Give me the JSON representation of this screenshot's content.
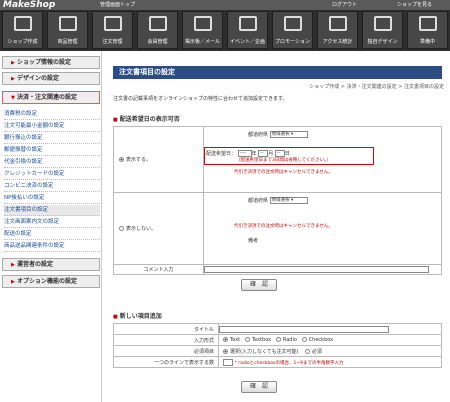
{
  "topbar": {
    "logo": "MakeShop",
    "admin_top": "管理画面トップ",
    "logout": "ログアウト",
    "to_shop": "ショップを見る"
  },
  "nav": [
    {
      "label": "ショップ作成"
    },
    {
      "label": "商品管理"
    },
    {
      "label": "注文管理"
    },
    {
      "label": "会員管理"
    },
    {
      "label": "掲示板／メール"
    },
    {
      "label": "イベント／企画"
    },
    {
      "label": "プロモーション"
    },
    {
      "label": "アクセス統計"
    },
    {
      "label": "独自デザイン"
    },
    {
      "label": "準備中"
    }
  ],
  "sidebar": {
    "head1": "ショップ情報の設定",
    "head2": "デザインの設定",
    "head3": "決済・注文関連の設定",
    "items": [
      "消費税の設定",
      "注文可能最小金額の設定",
      "銀行振込の設定",
      "郵便振替の設定",
      "代金引換の設定",
      "クレジットカードの設定",
      "コンビニ決済の設定",
      "NP後払いの設定",
      "注文書項目の設定",
      "注文画面案内文の設定",
      "配送の設定",
      "商品送品関連条件の設定"
    ],
    "head4": "運営者の設定",
    "head5": "オプション機能の設定"
  },
  "main": {
    "title": "注文書項目の設定",
    "breadcrumb": "ショップ作成 > 決済・注文関連の設定 > 注文書項目の設定",
    "description": "注文書の記載事項をオンラインショップの特性に合わせて追加設定できます。",
    "sec1": "配送希望日の表示可否",
    "show": "表示する。",
    "hide": "表示しない。",
    "pref_label": "都道府県",
    "pref_select": "地域選択",
    "date_label": "配送希望日：",
    "date_y": "----",
    "year": "年",
    "date_m": "--",
    "month": "月",
    "date_d": "--",
    "day": "日",
    "date_note": "（配送希望日まで3日間は省略してください。）",
    "cod_note": "代引き決済での注文時はキャンセルできません。",
    "remarks": "備考",
    "comment_label": "コメント入力",
    "confirm": "確　認",
    "sec2": "新しい項目追加",
    "title_label": "タイトル",
    "type_label": "入力形式",
    "types": [
      "Text",
      "Textbox",
      "Radio",
      "Checkbox"
    ],
    "required_label": "必須項目",
    "req_opt1": "選択(入力しなくても注文可能)",
    "req_opt2": "必須",
    "oneline_label": "一つのラインで表示する数",
    "oneline_note": "* radioとcheckboxの場合、1~9までの半角数字入力"
  },
  "colors": {
    "title_bg": "#2c4c86",
    "accent_red": "#cc0000",
    "nav_bg": "#2e2e2e"
  }
}
